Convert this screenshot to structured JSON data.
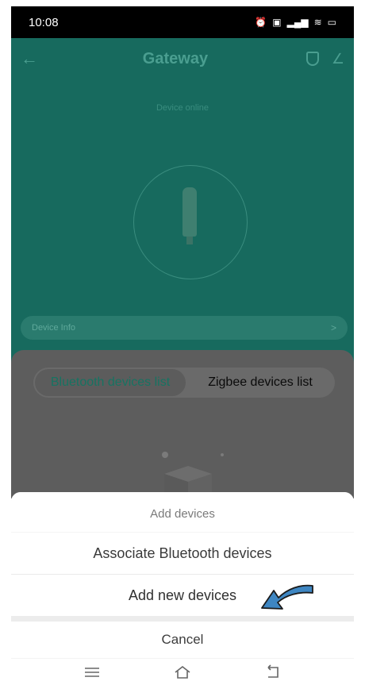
{
  "status_bar": {
    "time": "10:08",
    "icons": [
      "alarm-icon",
      "hd-icon",
      "signal-4g-icon",
      "wifi-icon",
      "battery-icon"
    ]
  },
  "header": {
    "title": "Gateway"
  },
  "device": {
    "status": "Device online",
    "info_label": "Device Info"
  },
  "tabs": [
    {
      "label": "Bluetooth devices list",
      "active": true
    },
    {
      "label": "Zigbee devices list",
      "active": false
    }
  ],
  "sheet": {
    "title": "Add devices",
    "option_associate": "Associate Bluetooth devices",
    "option_add_new": "Add new devices",
    "cancel": "Cancel"
  },
  "colors": {
    "teal_dimmed": "#176a5e",
    "arrow_blue": "#3e86c2",
    "sheet_background": "#f4f4f4"
  }
}
